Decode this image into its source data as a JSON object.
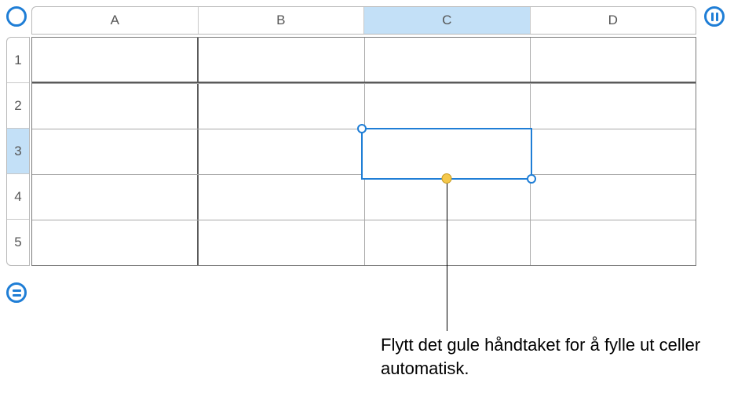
{
  "columns": [
    "A",
    "B",
    "C",
    "D"
  ],
  "rows": [
    "1",
    "2",
    "3",
    "4",
    "5"
  ],
  "selected_column_index": 2,
  "selected_row_index": 2,
  "callout_text": "Flytt det gule håndtaket for å fylle ut celler automatisk."
}
